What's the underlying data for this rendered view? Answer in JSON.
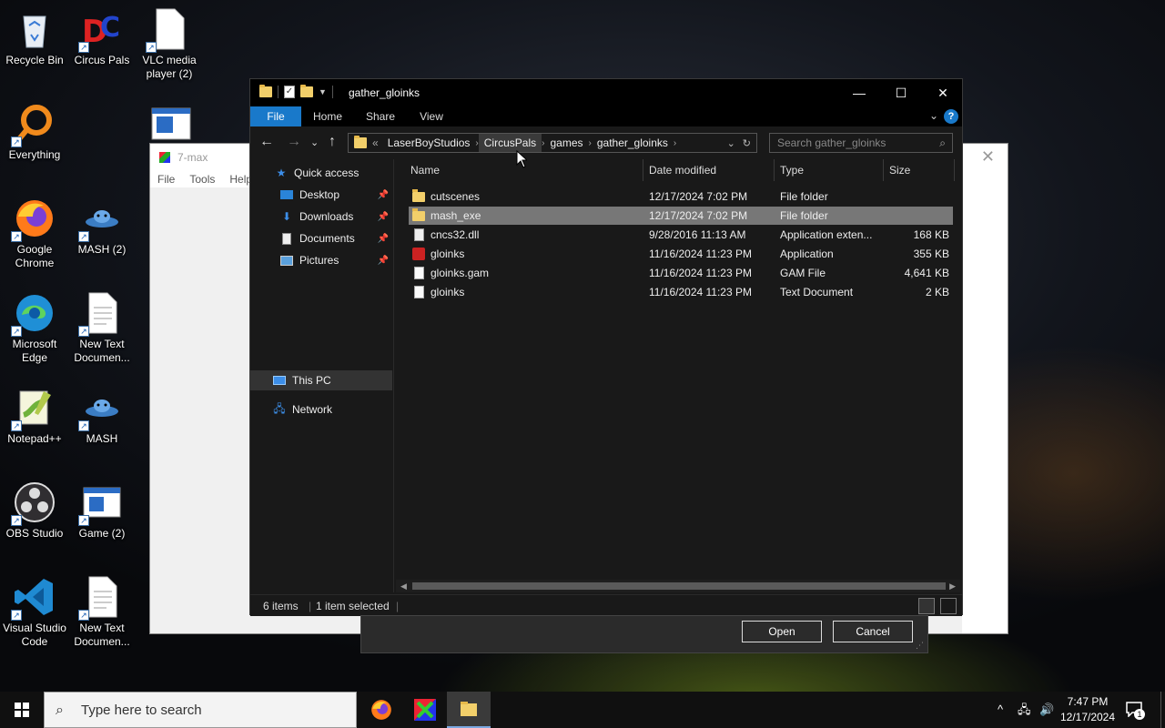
{
  "desktop": {
    "icons": [
      {
        "label": "Recycle Bin"
      },
      {
        "label": "Circus Pals"
      },
      {
        "label": "VLC media player (2)"
      },
      {
        "label": "Everything"
      },
      {
        "label": "Google Chrome"
      },
      {
        "label": "MASH (2)"
      },
      {
        "label": "Microsoft Edge"
      },
      {
        "label": "New Text Documen..."
      },
      {
        "label": "Notepad++"
      },
      {
        "label": "MASH"
      },
      {
        "label": "OBS Studio"
      },
      {
        "label": "Game (2)"
      },
      {
        "label": "Visual Studio Code"
      },
      {
        "label": "New Text Documen..."
      }
    ]
  },
  "bg_window": {
    "title": "7-max",
    "menu": [
      "File",
      "Tools",
      "Help"
    ]
  },
  "dialog": {
    "title": "gather_gloinks",
    "ribbon_tabs": [
      "File",
      "Home",
      "Share",
      "View"
    ],
    "breadcrumb": {
      "overflow": "«",
      "items": [
        "LaserBoyStudios",
        "CircusPals",
        "games",
        "gather_gloinks"
      ]
    },
    "search_placeholder": "Search gather_gloinks",
    "nav": {
      "quick_access": "Quick access",
      "pinned": [
        "Desktop",
        "Downloads",
        "Documents",
        "Pictures"
      ],
      "this_pc": "This PC",
      "network": "Network"
    },
    "columns": [
      "Name",
      "Date modified",
      "Type",
      "Size"
    ],
    "files": [
      {
        "name": "cutscenes",
        "date": "12/17/2024 7:02 PM",
        "type": "File folder",
        "size": "",
        "icon": "folder-icon"
      },
      {
        "name": "mash_exe",
        "date": "12/17/2024 7:02 PM",
        "type": "File folder",
        "size": "",
        "icon": "folder-icon"
      },
      {
        "name": "cncs32.dll",
        "date": "9/28/2016 11:13 AM",
        "type": "Application exten...",
        "size": "168 KB",
        "icon": "dll-icon"
      },
      {
        "name": "gloinks",
        "date": "11/16/2024 11:23 PM",
        "type": "Application",
        "size": "355 KB",
        "icon": "app-icon"
      },
      {
        "name": "gloinks.gam",
        "date": "11/16/2024 11:23 PM",
        "type": "GAM File",
        "size": "4,641 KB",
        "icon": "doc-icon"
      },
      {
        "name": "gloinks",
        "date": "11/16/2024 11:23 PM",
        "type": "Text Document",
        "size": "2 KB",
        "icon": "text-doc-icon"
      }
    ],
    "status": {
      "count": "6 items",
      "selected": "1 item selected"
    },
    "buttons": {
      "open": "Open",
      "cancel": "Cancel"
    }
  },
  "taskbar": {
    "search_placeholder": "Type here to search",
    "time": "7:47 PM",
    "date": "12/17/2024",
    "notification_count": "1"
  },
  "colors": {
    "accent": "#1979ca",
    "selection": "#777777",
    "dialog_bg": "#191919"
  }
}
